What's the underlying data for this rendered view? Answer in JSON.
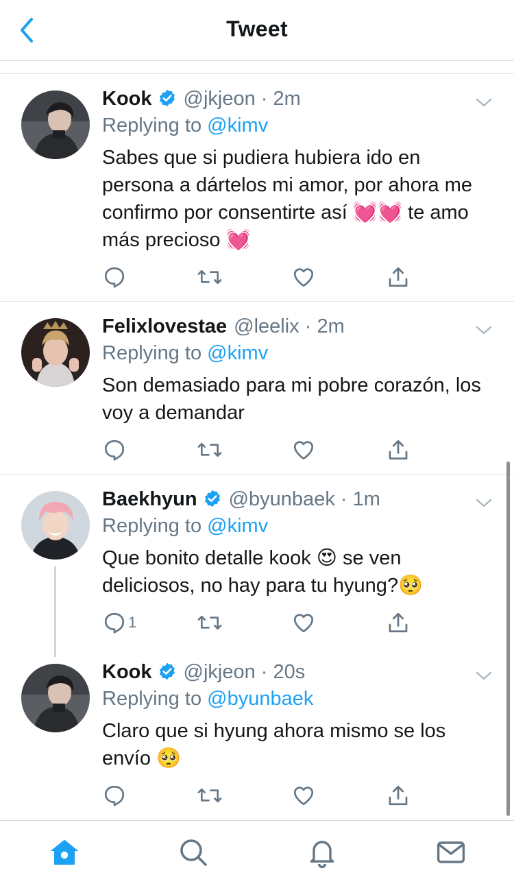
{
  "header": {
    "title": "Tweet"
  },
  "icons": {
    "back": "chevron-left-icon",
    "verified": "verified-badge-icon",
    "reply": "reply-icon",
    "retweet": "retweet-icon",
    "like": "heart-icon",
    "share": "share-icon",
    "more": "chevron-down-icon"
  },
  "colors": {
    "accent": "#1da1f2",
    "secondary_text": "#657786",
    "primary_text": "#14171a"
  },
  "tweets": [
    {
      "name": "Kook",
      "verified": true,
      "handle": "@jkjeon",
      "time": "2m",
      "replying_prefix": "Replying to",
      "replying_to": "@kimv",
      "text": "Sabes que si pudiera hubiera ido en persona a dártelos mi amor, por ahora me confirmo por consentirte así 💓💓 te amo más precioso 💓",
      "reply_count": ""
    },
    {
      "name": "Felixlovestae",
      "verified": false,
      "handle": "@leelix",
      "time": "2m",
      "replying_prefix": "Replying to",
      "replying_to": "@kimv",
      "text": "Son demasiado para mi pobre corazón, los voy a demandar",
      "reply_count": ""
    },
    {
      "name": "Baekhyun",
      "verified": true,
      "handle": "@byunbaek",
      "time": "1m",
      "replying_prefix": "Replying to",
      "replying_to": "@kimv",
      "text": "Que bonito detalle kook 😍 se ven deliciosos, no hay para tu hyung?🥺",
      "reply_count": "1"
    },
    {
      "name": "Kook",
      "verified": true,
      "handle": "@jkjeon",
      "time": "20s",
      "replying_prefix": "Replying to",
      "replying_to": "@byunbaek",
      "text": "Claro que si hyung ahora mismo se los envío 🥺",
      "reply_count": ""
    }
  ],
  "tabbar": {
    "items": [
      "home-icon",
      "search-icon",
      "notifications-icon",
      "messages-icon"
    ],
    "active": "home-icon"
  }
}
